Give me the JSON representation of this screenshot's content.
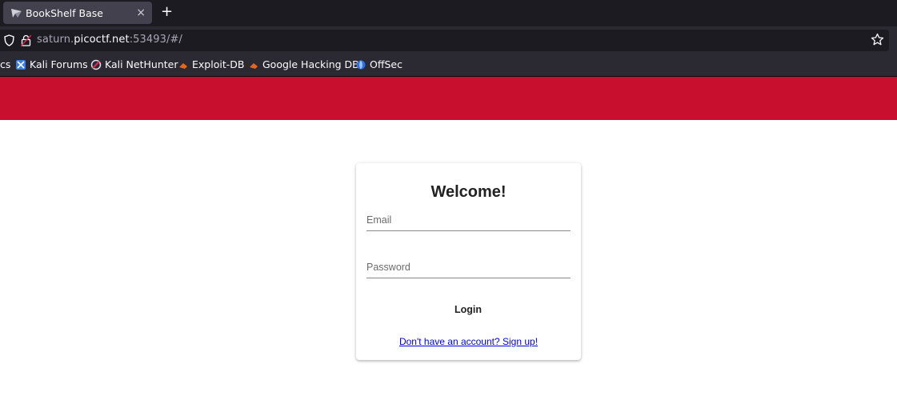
{
  "browser": {
    "tab": {
      "title": "BookShelf Base",
      "close": "×"
    },
    "new_tab": "+",
    "url": {
      "prefix": "saturn.",
      "domain": "picoctf.net",
      "suffix": ":53493/#/"
    },
    "bookmarks": [
      {
        "label": "cs",
        "icon": "none"
      },
      {
        "label": "Kali Forums",
        "icon": "kali-forums-icon"
      },
      {
        "label": "Kali NetHunter",
        "icon": "nethunter-icon"
      },
      {
        "label": "Exploit-DB",
        "icon": "exploitdb-icon"
      },
      {
        "label": "Google Hacking DB",
        "icon": "ghdb-icon"
      },
      {
        "label": "OffSec",
        "icon": "offsec-icon"
      }
    ]
  },
  "page": {
    "accent_color": "#c8102e",
    "card": {
      "title": "Welcome!",
      "email_label": "Email",
      "email_value": "",
      "password_label": "Password",
      "password_value": "",
      "login_label": "Login",
      "signup_link": "Don't have an account? Sign up!"
    }
  }
}
